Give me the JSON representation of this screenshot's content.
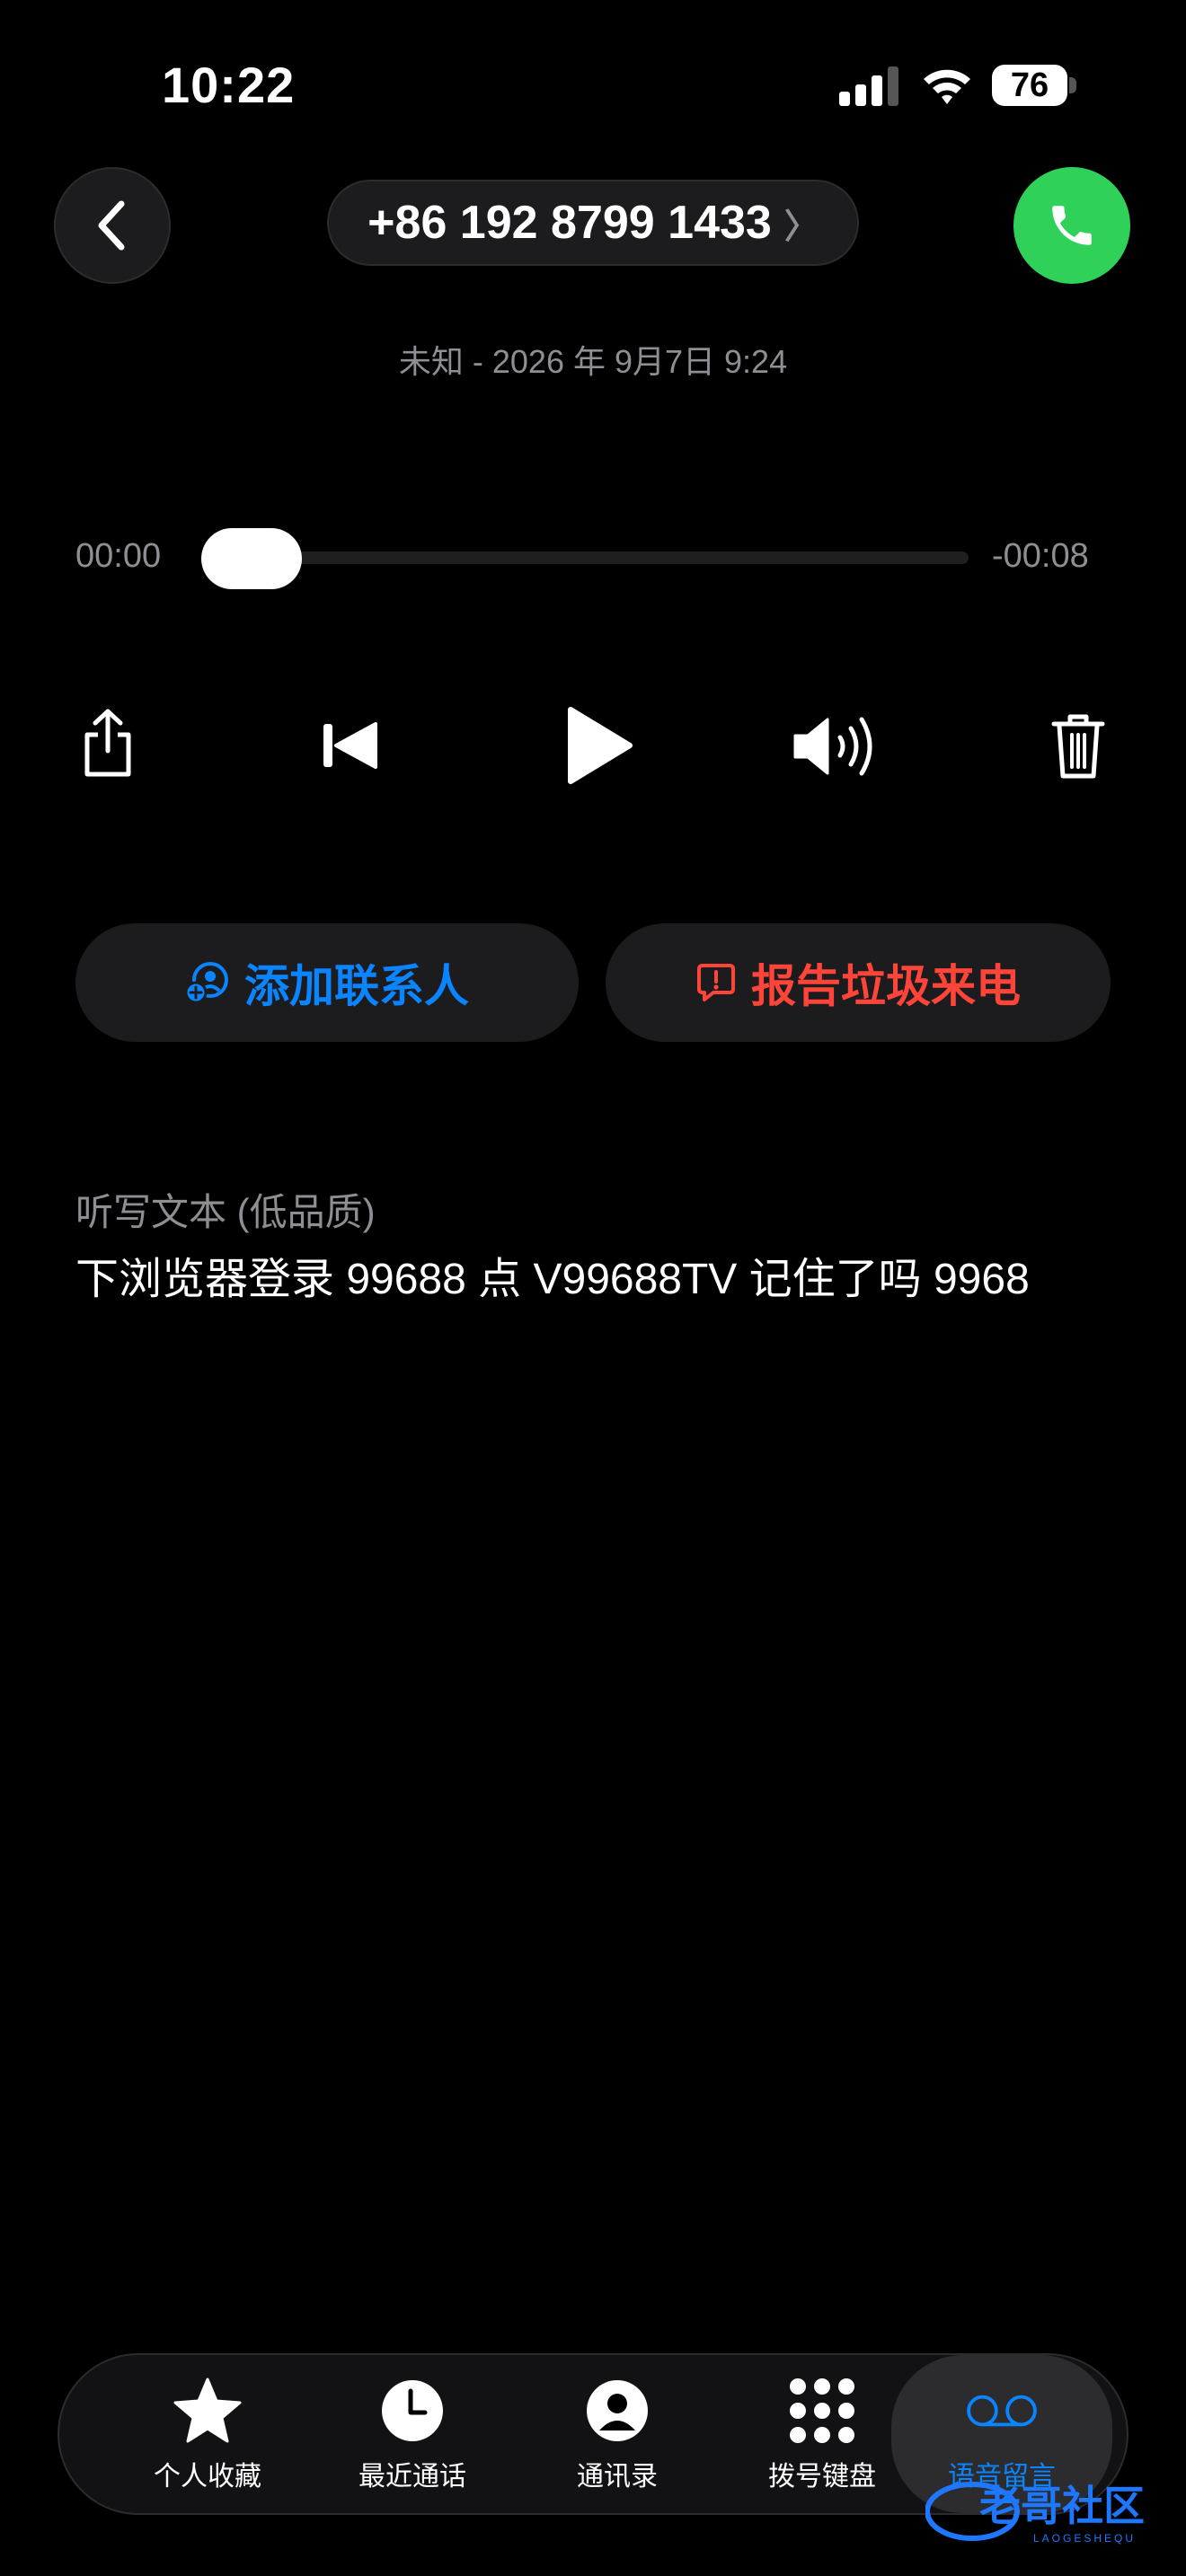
{
  "status_bar": {
    "time": "10:22",
    "battery": "76"
  },
  "header": {
    "phone_number": "+86 192 8799 1433",
    "chevron": "〉",
    "meta": "未知 - 2026 年 9月7日 9:24"
  },
  "player": {
    "elapsed": "00:00",
    "remaining": "-00:08",
    "progress": 0
  },
  "actions": {
    "add_contact": "添加联系人",
    "report_spam": "报告垃圾来电"
  },
  "transcript": {
    "label": "听写文本 (低品质)",
    "text": "下浏览器登录 99688 点 V99688TV 记住了吗 9968"
  },
  "tabs": [
    {
      "label": "个人收藏",
      "icon": "star-icon"
    },
    {
      "label": "最近通话",
      "icon": "clock-icon"
    },
    {
      "label": "通讯录",
      "icon": "person-icon"
    },
    {
      "label": "拨号键盘",
      "icon": "keypad-icon"
    },
    {
      "label": "语音留言",
      "icon": "voicemail-icon",
      "active": true
    }
  ],
  "watermark": {
    "text": "老哥社区",
    "sub": "LAOGESHEQU"
  },
  "colors": {
    "accent_blue": "#0a84ff",
    "danger_red": "#ff453a",
    "call_green": "#30d158"
  }
}
